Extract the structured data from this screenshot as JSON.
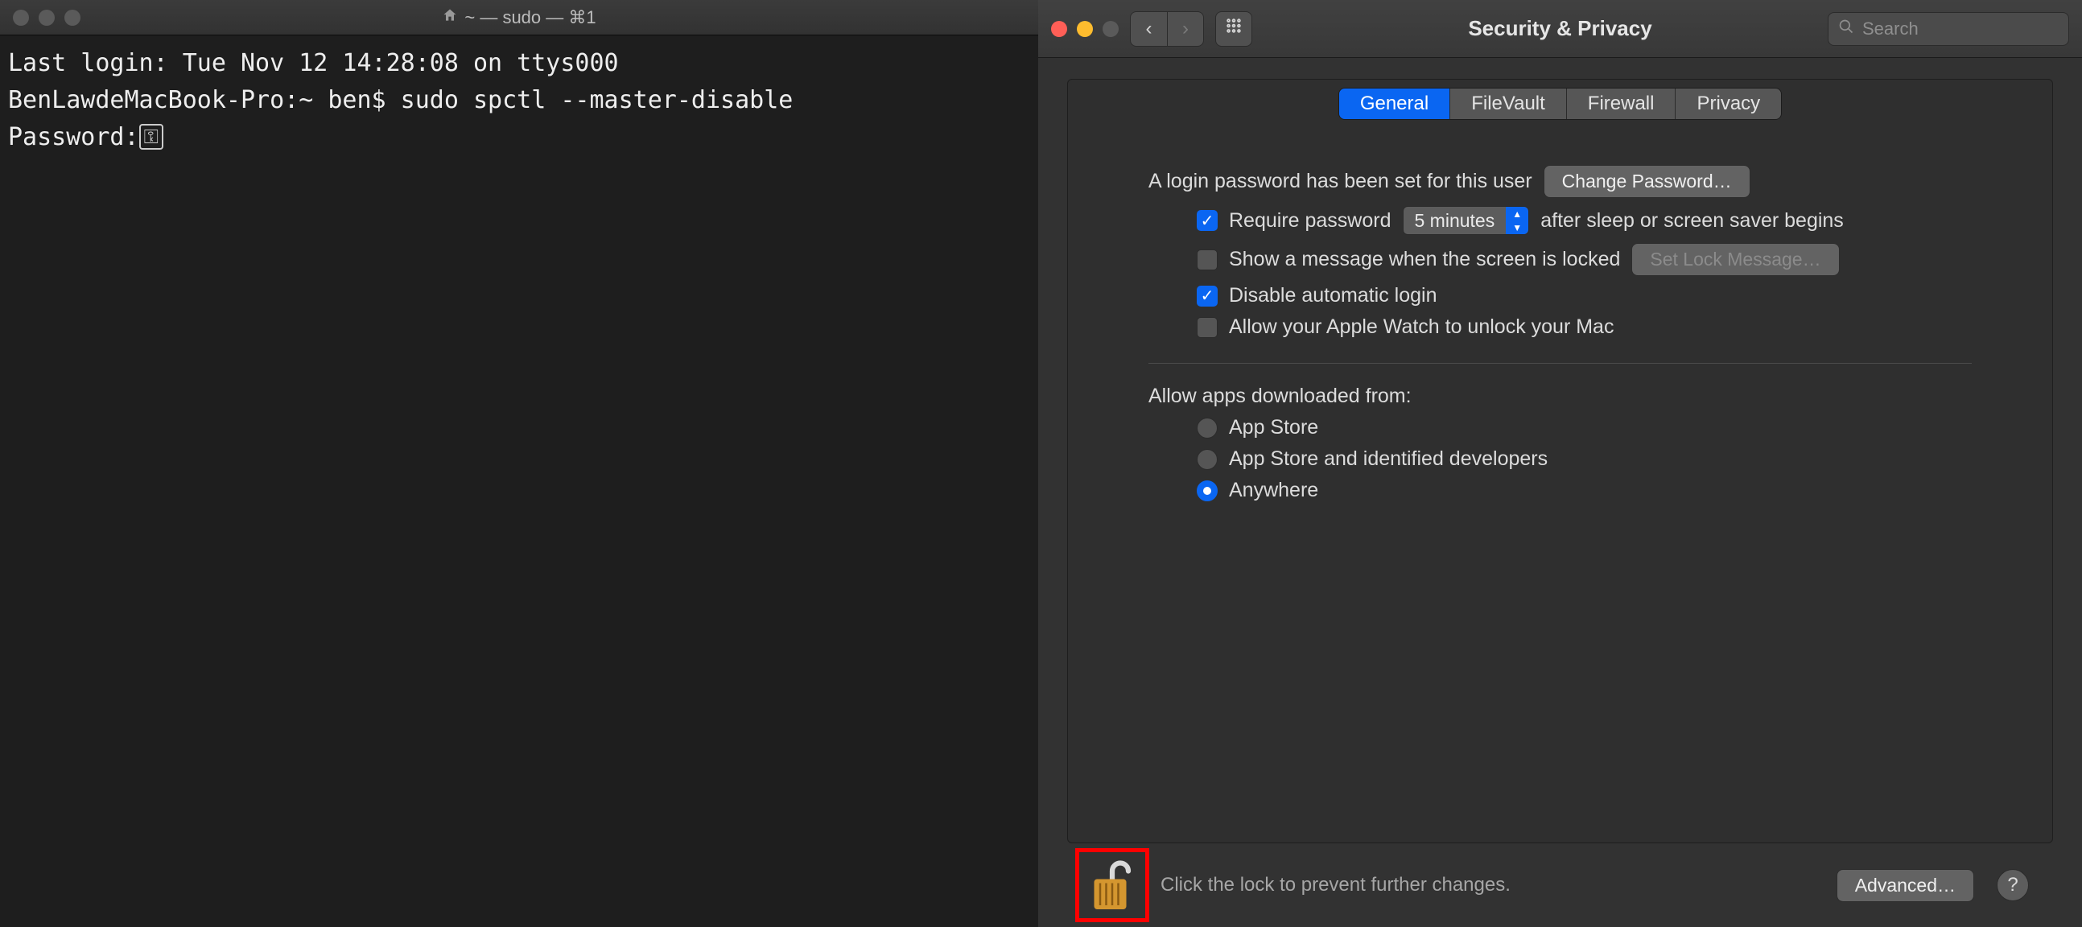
{
  "terminal": {
    "title": "~ — sudo — ⌘1",
    "line1": "Last login: Tue Nov 12 14:28:08 on ttys000",
    "line2": "BenLawdeMacBook-Pro:~ ben$ sudo spctl --master-disable",
    "password_prompt": "Password:"
  },
  "prefs": {
    "title": "Security & Privacy",
    "search_placeholder": "Search",
    "tabs": {
      "general": "General",
      "filevault": "FileVault",
      "firewall": "Firewall",
      "privacy": "Privacy"
    },
    "login_password_text": "A login password has been set for this user",
    "change_password_btn": "Change Password…",
    "require_password_label": "Require password",
    "require_password_delay": "5 minutes",
    "require_password_suffix": "after sleep or screen saver begins",
    "show_message_label": "Show a message when the screen is locked",
    "set_lock_message_btn": "Set Lock Message…",
    "disable_auto_login_label": "Disable automatic login",
    "allow_watch_label": "Allow your Apple Watch to unlock your Mac",
    "allow_apps_heading": "Allow apps downloaded from:",
    "radio_app_store": "App Store",
    "radio_identified": "App Store and identified developers",
    "radio_anywhere": "Anywhere",
    "lock_text": "Click the lock to prevent further changes.",
    "advanced_btn": "Advanced…"
  }
}
